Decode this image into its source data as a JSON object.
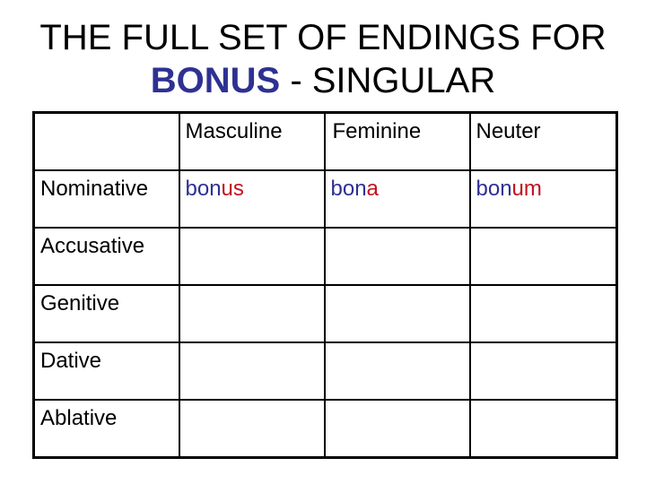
{
  "title": {
    "line1": "THE FULL SET OF ENDINGS FOR",
    "word": "BONUS",
    "line2_rest": " - SINGULAR"
  },
  "colors": {
    "stem": "#2e3192",
    "ending": "#c1121f",
    "title_highlight": "#2e3192"
  },
  "table": {
    "headers": [
      "",
      "Masculine",
      "Feminine",
      "Neuter"
    ],
    "rows": [
      {
        "case": "Nominative",
        "cells": [
          {
            "stem": "bon",
            "ending": "us"
          },
          {
            "stem": "bon",
            "ending": "a"
          },
          {
            "stem": "bon",
            "ending": "um"
          }
        ]
      },
      {
        "case": "Accusative",
        "cells": [
          {},
          {},
          {}
        ]
      },
      {
        "case": "Genitive",
        "cells": [
          {},
          {},
          {}
        ]
      },
      {
        "case": "Dative",
        "cells": [
          {},
          {},
          {}
        ]
      },
      {
        "case": "Ablative",
        "cells": [
          {},
          {},
          {}
        ]
      }
    ]
  }
}
